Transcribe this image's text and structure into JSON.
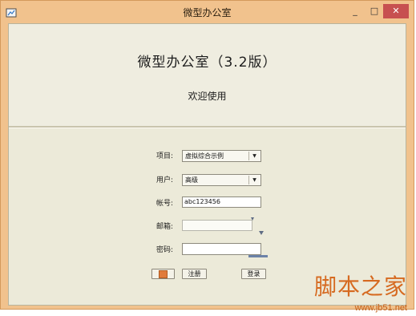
{
  "window": {
    "title": "微型办公室",
    "controls": {
      "minimize": "_",
      "maximize": "□",
      "close": "✕"
    }
  },
  "header": {
    "app_title": "微型办公室（3.2版）",
    "welcome": "欢迎使用"
  },
  "form": {
    "project_label": "项目:",
    "project_value": "虚拟综合示例",
    "user_label": "用户:",
    "user_value": "高级",
    "account_label": "帐号:",
    "account_value": "abc123456",
    "email_label": "邮箱:",
    "email_value": "",
    "password_label": "密码:",
    "password_value": ""
  },
  "buttons": {
    "register": "注册",
    "login": "登录"
  },
  "watermark": {
    "main": "脚本之家",
    "sub": "www.jb51.net"
  }
}
